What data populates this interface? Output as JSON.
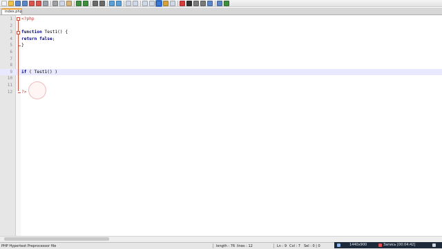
{
  "toolbar": {
    "buttons": [
      {
        "name": "new-file-icon",
        "color": "#f2f2f2"
      },
      {
        "name": "open-file-icon",
        "color": "#f0c24a"
      },
      {
        "name": "save-icon",
        "color": "#5b86c8"
      },
      {
        "name": "save-all-icon",
        "color": "#5b86c8"
      },
      {
        "name": "close-icon",
        "color": "#d9534f"
      },
      {
        "name": "close-all-icon",
        "color": "#d9534f"
      },
      {
        "name": "print-icon",
        "color": "#9aa3ad"
      },
      {
        "name": "sep"
      },
      {
        "name": "cut-icon",
        "color": "#a0a0a0"
      },
      {
        "name": "copy-icon",
        "color": "#cfd8e6"
      },
      {
        "name": "paste-icon",
        "color": "#d7b57a"
      },
      {
        "name": "sep"
      },
      {
        "name": "undo-icon",
        "color": "#3f8f3f"
      },
      {
        "name": "redo-icon",
        "color": "#3f8f3f"
      },
      {
        "name": "sep"
      },
      {
        "name": "find-icon",
        "color": "#6b6b6b"
      },
      {
        "name": "replace-icon",
        "color": "#6b6b6b"
      },
      {
        "name": "sep"
      },
      {
        "name": "zoom-in-icon",
        "color": "#5aa0d8"
      },
      {
        "name": "zoom-out-icon",
        "color": "#5aa0d8"
      },
      {
        "name": "sep"
      },
      {
        "name": "sync-vertical-icon",
        "color": "#cfd8e6"
      },
      {
        "name": "sync-horizontal-icon",
        "color": "#cfd8e6"
      },
      {
        "name": "sep"
      },
      {
        "name": "word-wrap-icon",
        "color": "#cfd8e6"
      },
      {
        "name": "show-all-chars-icon",
        "color": "#cfd8e6"
      },
      {
        "name": "indent-guide-icon",
        "color": "#3a79d6",
        "active": true
      },
      {
        "name": "user-language-icon",
        "color": "#d6a23a"
      },
      {
        "name": "doc-map-icon",
        "color": "#cfd8e6"
      },
      {
        "name": "sep"
      },
      {
        "name": "record-macro-icon",
        "color": "#d93b3b"
      },
      {
        "name": "stop-record-icon",
        "color": "#333333"
      },
      {
        "name": "play-macro-icon",
        "color": "#7a7a7a"
      },
      {
        "name": "play-multiple-icon",
        "color": "#7a7a7a"
      },
      {
        "name": "save-macro-icon",
        "color": "#5b86c8"
      },
      {
        "name": "sep"
      },
      {
        "name": "spell-check-icon",
        "color": "#5b86c8"
      },
      {
        "name": "plugin-icon",
        "color": "#3f8f3f"
      }
    ]
  },
  "tab": {
    "label": "index.php",
    "accent": "#f0a23a"
  },
  "editor": {
    "current_line": 9,
    "lines": [
      {
        "n": "1",
        "tokens": [
          {
            "t": "<?php",
            "c": "php-tag"
          }
        ]
      },
      {
        "n": "2",
        "tokens": []
      },
      {
        "n": "3",
        "tokens": [
          {
            "t": "function",
            "c": "kw"
          },
          {
            "t": " Test1() {",
            "c": "fn"
          }
        ]
      },
      {
        "n": "4",
        "tokens": [
          {
            "t": "return",
            "c": "kw"
          },
          {
            "t": " ",
            "c": "fn"
          },
          {
            "t": "false",
            "c": "kw"
          },
          {
            "t": ";",
            "c": "fn"
          }
        ]
      },
      {
        "n": "5",
        "tokens": [
          {
            "t": "}",
            "c": "fn"
          }
        ]
      },
      {
        "n": "6",
        "tokens": []
      },
      {
        "n": "7",
        "tokens": []
      },
      {
        "n": "8",
        "tokens": []
      },
      {
        "n": "9",
        "tokens": [
          {
            "t": "if",
            "c": "kw"
          },
          {
            "t": " ( Test1() )",
            "c": "fn"
          }
        ]
      },
      {
        "n": "10",
        "tokens": []
      },
      {
        "n": "11",
        "tokens": []
      },
      {
        "n": "12",
        "tokens": [
          {
            "t": "?>",
            "c": "php-tag"
          }
        ]
      }
    ]
  },
  "statusbar": {
    "file_type": "PHP Hypertext Preprocessor file",
    "length": "length : 76",
    "lines": "lines : 12",
    "ln": "Ln : 9",
    "col": "Col : 7",
    "sel": "Sel : 0 | 0"
  },
  "tray": {
    "resolution": "1440x900",
    "recording": "Запись [00:04:42]"
  }
}
